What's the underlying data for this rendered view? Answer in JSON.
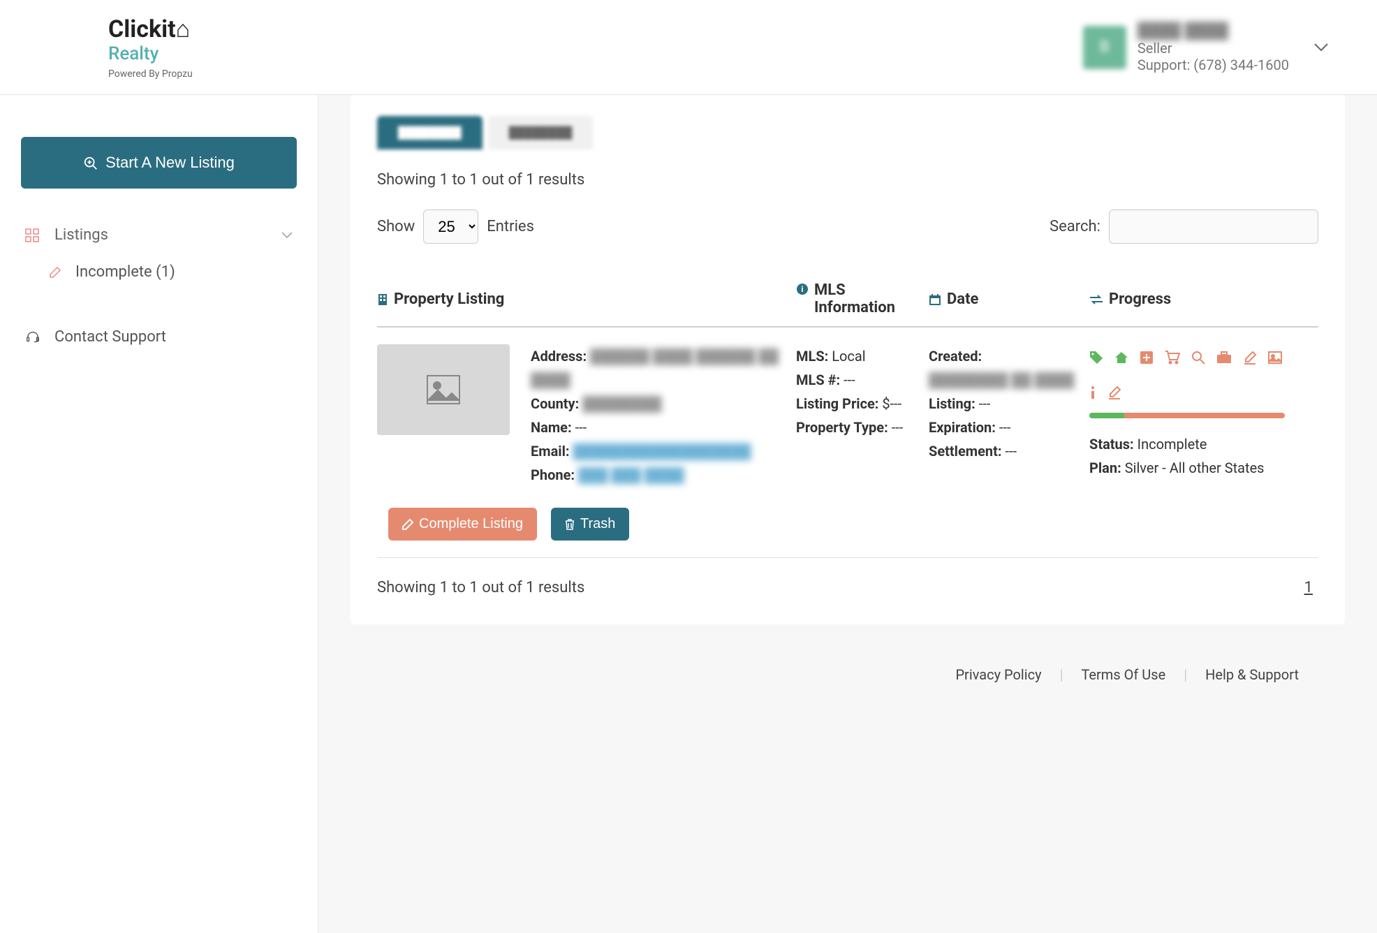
{
  "header": {
    "logo_line1a": "Clickit",
    "logo_line2": "Realty",
    "logo_sub": "Powered By Propzu",
    "user_name": "████ ████",
    "user_role": "Seller",
    "user_support": "Support: (678) 344-1600"
  },
  "sidebar": {
    "new_listing_btn": "Start A New Listing",
    "listings_label": "Listings",
    "incomplete_label": "Incomplete (1)",
    "contact_support_label": "Contact Support"
  },
  "main": {
    "results_top": "Showing 1 to 1 out of 1 results",
    "show_label": "Show",
    "entries_value": "25",
    "entries_label": "Entries",
    "search_label": "Search:",
    "columns": {
      "property": "Property Listing",
      "mls": "MLS Information",
      "date": "Date",
      "progress": "Progress"
    },
    "listing": {
      "address_label": "Address:",
      "address_value": "██████ ████ ██████ ██ ████",
      "county_label": "County:",
      "county_value": "████████",
      "name_label": "Name:",
      "name_value": "---",
      "email_label": "Email:",
      "email_value": "██████████████████",
      "phone_label": "Phone:",
      "phone_value": "███ ███ ████",
      "mls_label": "MLS:",
      "mls_value": "Local",
      "mlsnum_label": "MLS #:",
      "mlsnum_value": "---",
      "listing_price_label": "Listing Price:",
      "listing_price_value": "$---",
      "prop_type_label": "Property Type:",
      "prop_type_value": "---",
      "created_label": "Created:",
      "created_value": "████████ ██ ████",
      "listing_label": "Listing:",
      "listing_value": "---",
      "expiration_label": "Expiration:",
      "expiration_value": "---",
      "settlement_label": "Settlement:",
      "settlement_value": "---",
      "status_label": "Status:",
      "status_value": "Incomplete",
      "plan_label": "Plan:",
      "plan_value": "Silver - All other States"
    },
    "complete_btn": "Complete Listing",
    "trash_btn": "Trash",
    "results_bottom": "Showing 1 to 1 out of 1 results",
    "page": "1"
  },
  "footer": {
    "privacy": "Privacy Policy",
    "terms": "Terms Of Use",
    "help": "Help & Support"
  }
}
